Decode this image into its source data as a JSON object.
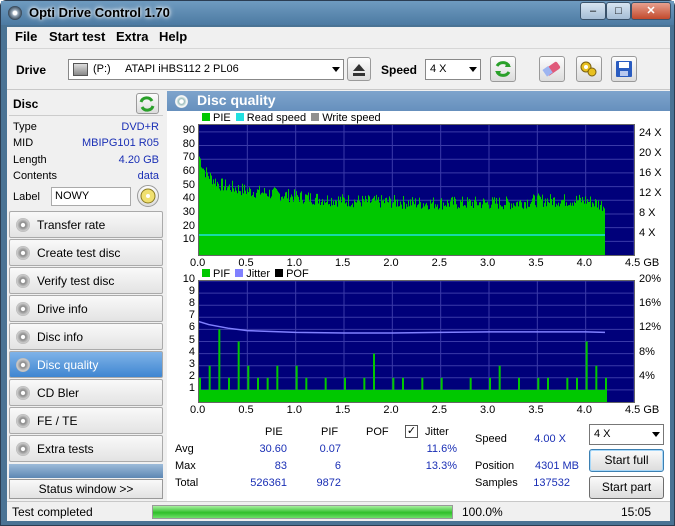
{
  "window": {
    "title": "Opti Drive Control 1.70",
    "minimize": "‒",
    "maximize": "□",
    "close": "✕"
  },
  "menu": [
    "File",
    "Start test",
    "Extra",
    "Help"
  ],
  "toolbar": {
    "drive_label": "Drive",
    "drive_letter": "(P:)",
    "drive_name": "ATAPI iHBS112  2 PL06",
    "speed_label": "Speed",
    "speed_value": "4 X",
    "icons": [
      "drive-icon",
      "eject-icon",
      "refresh-icon",
      "eraser-icon",
      "settings-icon",
      "save-icon"
    ]
  },
  "disc": {
    "header": "Disc",
    "rows": [
      {
        "label": "Type",
        "value": "DVD+R"
      },
      {
        "label": "MID",
        "value": "MBIPG101 R05"
      },
      {
        "label": "Length",
        "value": "4.20 GB"
      },
      {
        "label": "Contents",
        "value": "data"
      }
    ],
    "label_label": "Label",
    "label_value": "NOWY"
  },
  "nav": [
    {
      "label": "Transfer rate",
      "active": false
    },
    {
      "label": "Create test disc",
      "active": false
    },
    {
      "label": "Verify test disc",
      "active": false
    },
    {
      "label": "Drive info",
      "active": false
    },
    {
      "label": "Disc info",
      "active": false
    },
    {
      "label": "Disc quality",
      "active": true
    },
    {
      "label": "CD Bler",
      "active": false
    },
    {
      "label": "FE / TE",
      "active": false
    },
    {
      "label": "Extra tests",
      "active": false
    }
  ],
  "status_window_button": "Status window >>",
  "panel_title": "Disc quality",
  "chart_top": {
    "legend": [
      {
        "label": "PIE",
        "color": "#00c800"
      },
      {
        "label": "Read speed",
        "color": "#20e0e0"
      },
      {
        "label": "Write speed",
        "color": "#909090"
      }
    ],
    "y_left_ticks": [
      "90",
      "80",
      "70",
      "60",
      "50",
      "40",
      "30",
      "20",
      "10"
    ],
    "y_right_ticks": [
      "24 X",
      "20 X",
      "16 X",
      "12 X",
      "8 X",
      "4 X"
    ],
    "x_ticks": [
      "0.0",
      "0.5",
      "1.0",
      "1.5",
      "2.0",
      "2.5",
      "3.0",
      "3.5",
      "4.0",
      "4.5 GB"
    ]
  },
  "chart_bottom": {
    "legend": [
      {
        "label": "PIF",
        "color": "#00c800"
      },
      {
        "label": "Jitter",
        "color": "#8080ff"
      },
      {
        "label": "POF",
        "color": "#000000"
      }
    ],
    "y_left_ticks": [
      "10",
      "9",
      "8",
      "7",
      "6",
      "5",
      "4",
      "3",
      "2",
      "1"
    ],
    "y_right_ticks": [
      "20%",
      "16%",
      "12%",
      "8%",
      "4%"
    ],
    "x_ticks": [
      "0.0",
      "0.5",
      "1.0",
      "1.5",
      "2.0",
      "2.5",
      "3.0",
      "3.5",
      "4.0",
      "4.5 GB"
    ]
  },
  "chart_data": [
    {
      "type": "area",
      "title": "",
      "xlabel": "GB",
      "ylabel": "PIE",
      "xlim": [
        0,
        4.5
      ],
      "ylim": [
        0,
        95
      ],
      "ylim_right": [
        0,
        26
      ],
      "series": [
        {
          "name": "PIE",
          "x": [
            0.0,
            0.05,
            0.1,
            0.2,
            0.3,
            0.5,
            0.75,
            1.0,
            1.25,
            1.5,
            1.75,
            2.0,
            2.25,
            2.5,
            2.75,
            3.0,
            3.25,
            3.5,
            3.75,
            4.0,
            4.1,
            4.2
          ],
          "values": [
            72,
            62,
            58,
            52,
            50,
            47,
            45,
            43,
            41,
            40,
            39,
            39,
            38,
            38,
            38,
            38,
            38,
            40,
            40,
            40,
            38,
            36
          ]
        },
        {
          "name": "Read speed",
          "x": [
            0.0,
            4.2
          ],
          "values": [
            4,
            4
          ]
        }
      ]
    },
    {
      "type": "bar",
      "title": "",
      "xlabel": "GB",
      "ylabel": "PIF",
      "xlim": [
        0,
        4.5
      ],
      "ylim": [
        0,
        10
      ],
      "ylim_right": [
        0,
        20
      ],
      "series": [
        {
          "name": "PIF",
          "x": [
            0.0,
            0.1,
            0.2,
            0.3,
            0.4,
            0.5,
            0.6,
            0.7,
            0.8,
            0.9,
            1.0,
            1.1,
            1.2,
            1.3,
            1.4,
            1.5,
            1.6,
            1.7,
            1.8,
            1.9,
            2.0,
            2.1,
            2.2,
            2.3,
            2.4,
            2.5,
            2.6,
            2.7,
            2.8,
            2.9,
            3.0,
            3.1,
            3.2,
            3.3,
            3.4,
            3.5,
            3.6,
            3.7,
            3.8,
            3.9,
            4.0,
            4.1,
            4.2
          ],
          "values": [
            2,
            3,
            6,
            2,
            5,
            3,
            2,
            2,
            3,
            1,
            3,
            2,
            1,
            2,
            1,
            2,
            1,
            2,
            4,
            1,
            2,
            2,
            1,
            2,
            1,
            2,
            1,
            1,
            2,
            1,
            2,
            3,
            1,
            2,
            1,
            2,
            2,
            1,
            2,
            2,
            5,
            3,
            2
          ]
        },
        {
          "name": "Jitter",
          "x": [
            0.0,
            0.1,
            0.3,
            0.5,
            1.0,
            1.5,
            2.0,
            2.5,
            3.0,
            3.5,
            4.0,
            4.2
          ],
          "values": [
            13.3,
            12.8,
            12.2,
            11.8,
            11.5,
            11.4,
            11.4,
            11.5,
            11.6,
            11.6,
            11.6,
            11.5
          ]
        }
      ]
    }
  ],
  "stats": {
    "headers": [
      "PIE",
      "PIF",
      "POF",
      "Jitter"
    ],
    "jitter_checked": true,
    "rows": [
      {
        "label": "Avg",
        "pie": "30.60",
        "pif": "0.07",
        "pof": "",
        "jitter": "11.6%"
      },
      {
        "label": "Max",
        "pie": "83",
        "pif": "6",
        "pof": "",
        "jitter": "13.3%"
      },
      {
        "label": "Total",
        "pie": "526361",
        "pif": "9872",
        "pof": "",
        "jitter": ""
      }
    ],
    "speed_label": "Speed",
    "speed_value": "4.00 X",
    "position_label": "Position",
    "position_value": "4301 MB",
    "samples_label": "Samples",
    "samples_value": "137532",
    "speed_select": "4 X",
    "start_full": "Start full",
    "start_part": "Start part"
  },
  "status": {
    "text": "Test completed",
    "progress": 1.0,
    "progress_text": "100.0%",
    "time": "15:05"
  }
}
